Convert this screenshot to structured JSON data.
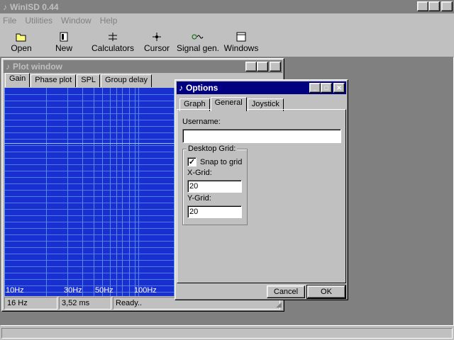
{
  "app": {
    "title": "WinISD 0.44"
  },
  "menu": [
    "File",
    "Utilities",
    "Window",
    "Help"
  ],
  "toolbar": [
    {
      "label": "Open",
      "icon": "folder-open-icon"
    },
    {
      "label": "New",
      "icon": "new-document-icon"
    },
    {
      "label": "Calculators",
      "icon": "calculator-icon"
    },
    {
      "label": "Cursor",
      "icon": "crosshair-icon"
    },
    {
      "label": "Signal gen.",
      "icon": "signal-generator-icon"
    },
    {
      "label": "Windows",
      "icon": "windows-icon"
    }
  ],
  "plot_window": {
    "title": "Plot window",
    "tabs": [
      "Gain",
      "Phase plot",
      "SPL",
      "Group delay"
    ],
    "active_tab": "Gain",
    "x_ticks": [
      "10Hz",
      "30Hz",
      "50Hz",
      "100Hz"
    ],
    "status": {
      "freq": "16 Hz",
      "time": "3,52 ms",
      "state": "Ready.."
    }
  },
  "options": {
    "title": "Options",
    "tabs": [
      "Graph",
      "General",
      "Joystick"
    ],
    "active_tab": "General",
    "username_label": "Username:",
    "username_value": "",
    "desktop_grid_label": "Desktop Grid:",
    "snap_label": "Snap to grid",
    "snap_checked": true,
    "xgrid_label": "X-Grid:",
    "xgrid_value": "20",
    "ygrid_label": "Y-Grid:",
    "ygrid_value": "20",
    "cancel_label": "Cancel",
    "ok_label": "OK"
  },
  "colors": {
    "plot_bg": "#1a2fd0",
    "active_title": "#000080",
    "inactive_title": "#808080"
  }
}
